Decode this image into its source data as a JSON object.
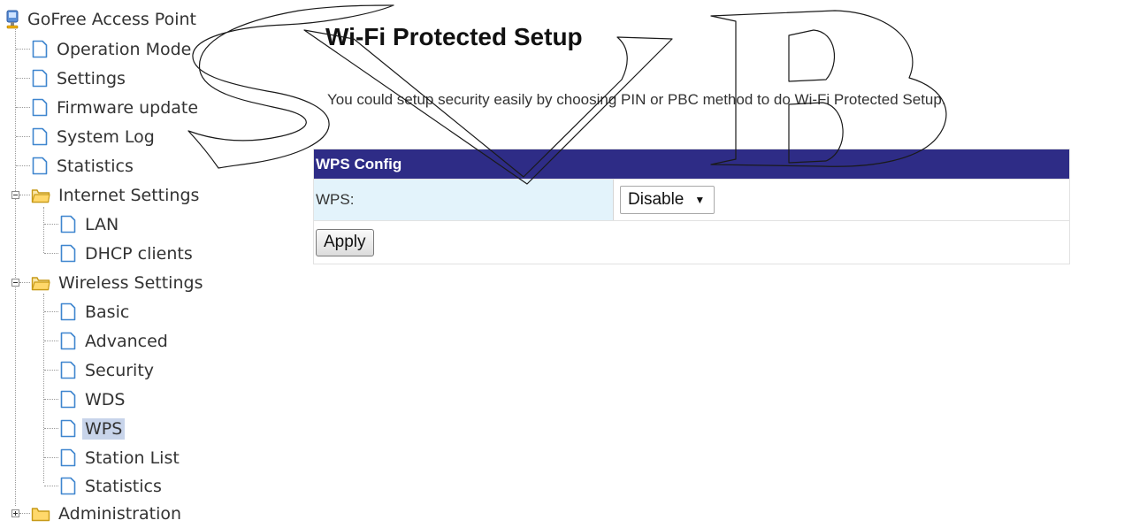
{
  "tree": {
    "root_label": "GoFree Access Point",
    "items": [
      {
        "label": "Operation Mode"
      },
      {
        "label": "Settings"
      },
      {
        "label": "Firmware update"
      },
      {
        "label": "System Log"
      },
      {
        "label": "Statistics"
      }
    ],
    "internet": {
      "label": "Internet Settings",
      "children": [
        {
          "label": "LAN"
        },
        {
          "label": "DHCP clients"
        }
      ]
    },
    "wireless": {
      "label": "Wireless Settings",
      "children": [
        {
          "label": "Basic"
        },
        {
          "label": "Advanced"
        },
        {
          "label": "Security"
        },
        {
          "label": "WDS"
        },
        {
          "label": "WPS"
        },
        {
          "label": "Station List"
        },
        {
          "label": "Statistics"
        }
      ]
    },
    "administration": {
      "label": "Administration"
    }
  },
  "icons": {
    "root": "network-computer-icon",
    "page": "page-icon",
    "folder": "folder-icon",
    "expanded": "minus-icon",
    "collapsed": "plus-icon"
  },
  "page": {
    "title": "Wi-Fi Protected Setup",
    "description": "You could setup security easily by choosing PIN or PBC method to do Wi-Fi Protected Setup."
  },
  "wps_config": {
    "header": "WPS Config",
    "field_label": "WPS:",
    "selected_value": "Disable",
    "apply_label": "Apply"
  },
  "watermark": {
    "text": "SVB"
  },
  "colors": {
    "header_bg": "#2e2c86",
    "label_cell_bg": "#e3f3fb",
    "selected_item_bg": "#c8d4ea"
  }
}
